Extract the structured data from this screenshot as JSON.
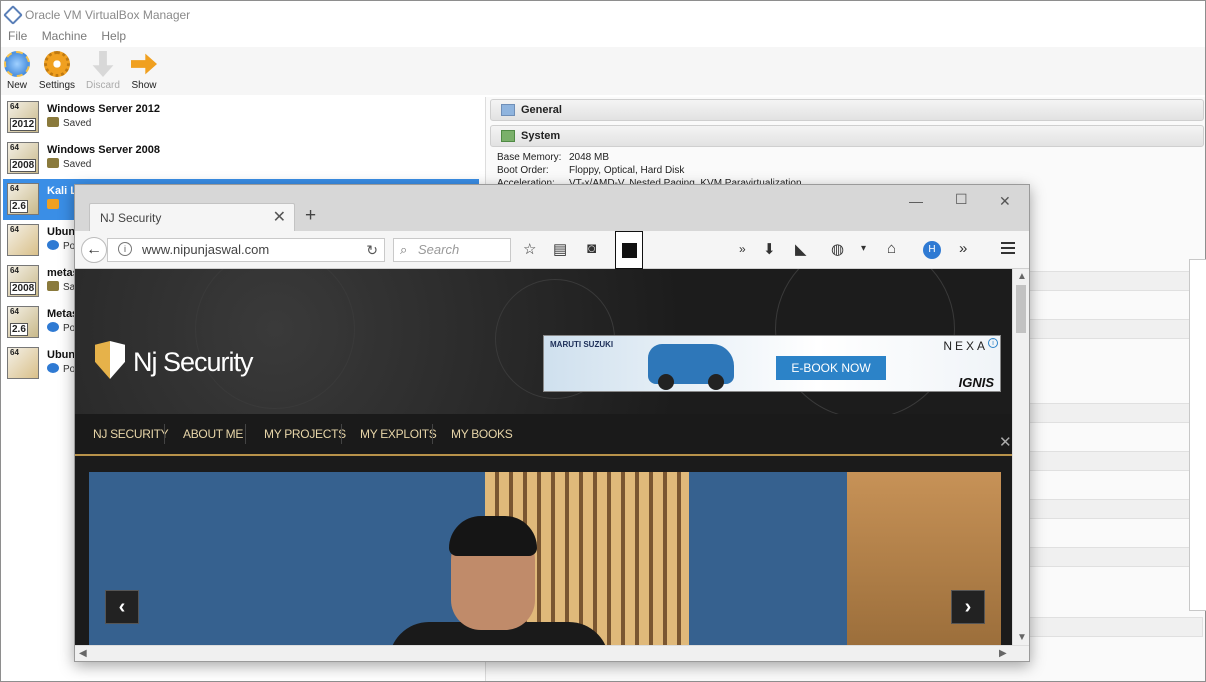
{
  "vbox": {
    "title": "Oracle VM VirtualBox Manager",
    "menu": [
      "File",
      "Machine",
      "Help"
    ],
    "toolbar": {
      "new": "New",
      "settings": "Settings",
      "discard": "Discard",
      "show": "Show"
    },
    "vms": [
      {
        "name": "Windows Server 2012",
        "state": "Saved",
        "badge": "2012",
        "arch": "64"
      },
      {
        "name": "Windows Server 2008",
        "state": "Saved",
        "badge": "2008",
        "arch": "64"
      },
      {
        "name": "Kali Li",
        "state": "",
        "badge": "2.6",
        "arch": "64"
      },
      {
        "name": "Ubunt",
        "state": "Po",
        "badge": "",
        "arch": "64"
      },
      {
        "name": "metas",
        "state": "Sa",
        "badge": "2008",
        "arch": "64"
      },
      {
        "name": "Metas",
        "state": "Po",
        "badge": "2.6",
        "arch": "64"
      },
      {
        "name": "Ubunt",
        "state": "Po",
        "badge": "",
        "arch": "64"
      }
    ],
    "details": {
      "general": "General",
      "system": "System",
      "base_memory_label": "Base Memory:",
      "base_memory": "2048 MB",
      "boot_order_label": "Boot Order:",
      "boot_order": "Floppy, Optical, Hard Disk",
      "acceleration_label": "Acceleration:",
      "acceleration": "VT-x/AMD-V, Nested Paging, KVM Paravirtualization"
    }
  },
  "firefox": {
    "tab_title": "NJ Security",
    "url": "www.nipunjaswal.com",
    "search_placeholder": "Search",
    "profile_initial": "H"
  },
  "site": {
    "logo": "Nj Security",
    "nav": [
      "NJ SECURITY",
      "ABOUT ME",
      "MY PROJECTS",
      "MY EXPLOITS",
      "MY BOOKS"
    ],
    "ad": {
      "brand": "MARUTI SUZUKI",
      "button": "E-BOOK NOW",
      "nexa": "NEXA",
      "model": "IGNIS"
    }
  }
}
